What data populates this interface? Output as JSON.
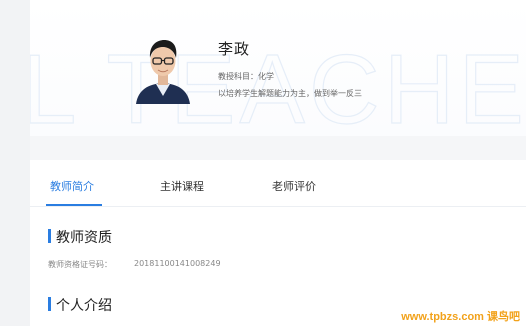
{
  "hero": {
    "name": "李政",
    "subject": "教授科目：化学",
    "motto": "以培养学生解题能力为主，做到举一反三",
    "watermark_text": "L TEACHER"
  },
  "tabs": [
    {
      "label": "教师简介",
      "active": true
    },
    {
      "label": "主讲课程",
      "active": false
    },
    {
      "label": "老师评价",
      "active": false
    }
  ],
  "qualification": {
    "title": "教师资质",
    "cert_label": "教师资格证号码：",
    "cert_number": "20181100141008249"
  },
  "intro": {
    "title": "个人介绍"
  },
  "site_watermark": "www.tpbzs.com 课鸟吧",
  "colors": {
    "accent": "#2a7de1",
    "watermark_orange": "#f2a21b"
  }
}
